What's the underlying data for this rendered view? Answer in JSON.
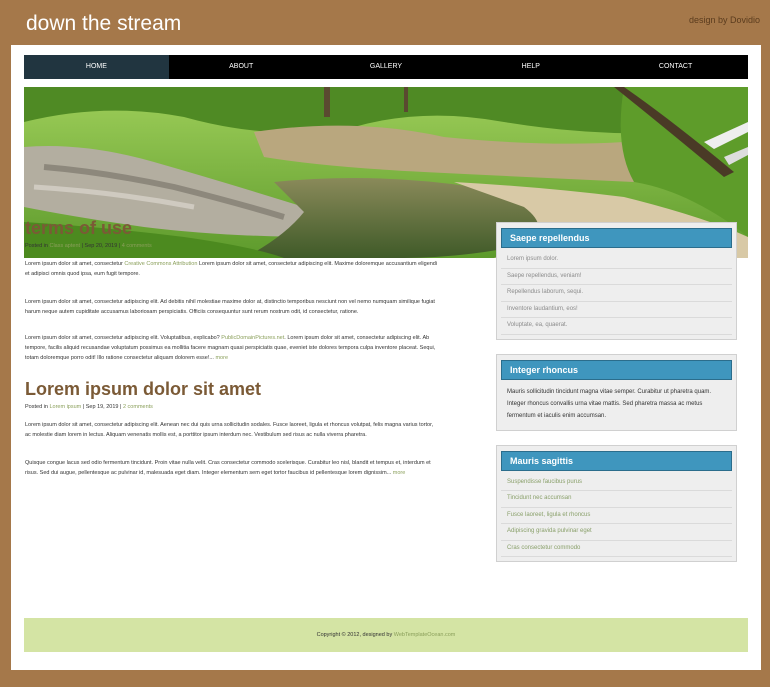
{
  "header": {
    "site_title": "down the stream",
    "credit": "design by Dovidio"
  },
  "nav": {
    "items": [
      "HOME",
      "ABOUT",
      "GALLERY",
      "HELP",
      "CONTACT"
    ],
    "active": "HOME"
  },
  "posts": [
    {
      "title": "terms of use",
      "meta_prefix": "Posted in",
      "category": "Class aptent",
      "date": "| Sep 20, 2019 |",
      "comments": "4 comments",
      "paragraphs": [
        {
          "before": "Lorem ipsum dolor sit amet, consectetur ",
          "link": "Creative Commons Attribution",
          "after": " Lorem ipsum dolor sit amet, consectetur adipiscing elit. Maxime doloremque accusantium eligendi et adipisci omnis quod ipsa, eum fugit tempore."
        },
        {
          "text": "Lorem ipsum dolor sit amet, consectetur adipiscing elit. Ad debitis nihil molestiae maxime dolor at, distinctio temporibus nesciunt non vel nemo numquam similique fugiat harum neque autem cupiditate accusamus laboriosam perspiciatis. Officiis consequuntur sunt rerum nostrum odit, id consectetur, ratione."
        },
        {
          "before": "Lorem ipsum dolor sit amet, consectetur adipiscing elit. Voluptatibus, explicabo? ",
          "link": "PublicDomainPictures.net",
          "after": ". Lorem ipsum dolor sit amet, consectetur adipiscing elit. Ab tempore, facilis aliquid recusandae voluptatum possimus ea mollitia facere magnam quasi perspiciatis quae, eveniet iste dolores tempora culpa inventore placeat. Sequi, totam doloremque porro odit! Illo ratione consectetur aliquam dolorem esse!...",
          "more": "more"
        }
      ]
    },
    {
      "title": "Lorem ipsum dolor sit amet",
      "meta_prefix": "Posted in",
      "category": "Lorem ipsum",
      "date": "| Sep 19, 2019 |",
      "comments": "2 comments",
      "paragraphs": [
        {
          "text": "Lorem ipsum dolor sit amet, consectetur adipiscing elit. Aenean nec dui quis urna sollicitudin sodales. Fusce laoreet, ligula et rhoncus volutpat, felis magna varius tortor, ac molestie diam lorem in lectus. Aliquam venenatis mollis est, a porttitor ipsum interdum nec. Vestibulum sed risus ac nulla viverra pharetra."
        },
        {
          "text": "Quisque congue lacus sed odio fermentum tincidunt. Proin vitae nulla velit. Cras consectetur commodo scelerisque. Curabitur leo nisl, blandit et tempus et, interdum et risus. Sed dui augue, pellentesque ac pulvinar id, malesuada eget diam. Integer elementum sem eget tortor faucibus id pellentesque lorem dignissim...",
          "more": "more"
        }
      ]
    }
  ],
  "sidebar": {
    "widget1": {
      "title": "Saepe repellendus",
      "items": [
        "Lorem ipsum dolor.",
        "Saepe repellendus, veniam!",
        "Repellendus laborum, sequi.",
        "Inventore laudantium, eos!",
        "Voluptate, ea, quaerat."
      ]
    },
    "widget2": {
      "title": "Integer rhoncus",
      "text": "Mauris sollicitudin tincidunt magna vitae semper. Curabitur ut pharetra quam. Integer rhoncus convallis urna vitae mattis. Sed pharetra massa ac metus fermentum et iaculis enim accumsan."
    },
    "widget3": {
      "title": "Mauris sagittis",
      "items": [
        "Suspendisse faucibus purus",
        "Tincidunt nec accumsan",
        "Fusce laoreet, ligula et rhoncus",
        "Adipiscing gravida pulvinar eget",
        "Cras consectetur commodo"
      ]
    }
  },
  "footer": {
    "text": "Copyright © 2012, designed by",
    "link": "WebTemplateOcean.com"
  },
  "colors": {
    "background": "#a5784a",
    "nav_active": "#213540",
    "title_brown": "#7b5a36",
    "widget_blue": "#3f96be",
    "footer_green": "#d4e4a4"
  }
}
